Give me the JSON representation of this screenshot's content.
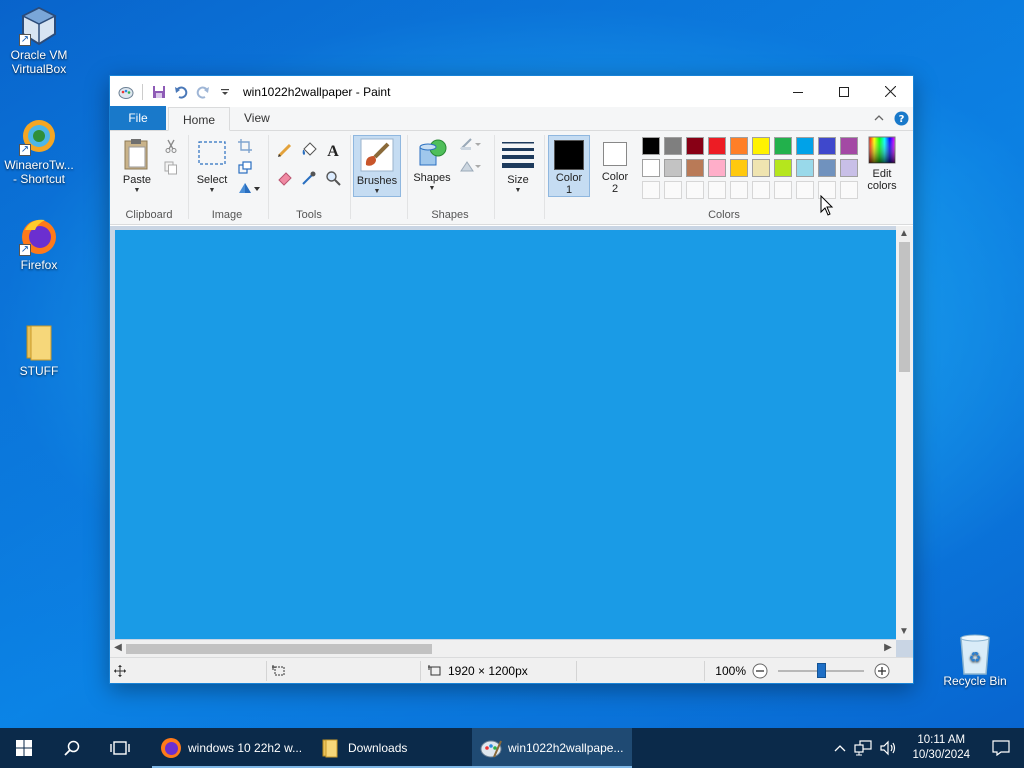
{
  "desktop": {
    "icons": [
      {
        "label": "Oracle VM VirtualBox"
      },
      {
        "label": "WinaeroTw... - Shortcut"
      },
      {
        "label": "Firefox"
      },
      {
        "label": "STUFF"
      },
      {
        "label": "Recycle Bin"
      }
    ]
  },
  "window": {
    "title": "win1022h2wallpaper - Paint"
  },
  "ribbon": {
    "tabs": {
      "file": "File",
      "home": "Home",
      "view": "View"
    },
    "groups": {
      "clipboard": {
        "label": "Clipboard",
        "paste": "Paste"
      },
      "image": {
        "label": "Image",
        "select": "Select"
      },
      "tools": {
        "label": "Tools"
      },
      "brushes": {
        "label": "Brushes"
      },
      "shapes": {
        "label": "Shapes",
        "shapes_btn": "Shapes"
      },
      "size": {
        "label": "Size"
      },
      "colors": {
        "label": "Colors",
        "color1": "Color\n1",
        "color1_a": "Color",
        "color1_b": "1",
        "color2_a": "Color",
        "color2_b": "2",
        "edit_a": "Edit",
        "edit_b": "colors",
        "color1_value": "#000000",
        "color2_value": "#ffffff",
        "palette_row1": [
          "#000000",
          "#7f7f7f",
          "#880015",
          "#ed1c24",
          "#ff7f27",
          "#fff200",
          "#22b14c",
          "#00a2e8",
          "#3f48cc",
          "#a349a4"
        ],
        "palette_row2": [
          "#ffffff",
          "#c3c3c3",
          "#b97a57",
          "#ffaec9",
          "#ffc90e",
          "#efe4b0",
          "#b5e61d",
          "#99d9ea",
          "#7092be",
          "#c8bfe7"
        ]
      }
    }
  },
  "canvas": {
    "fill_color": "#1a9be6"
  },
  "status": {
    "dimensions": "1920 × 1200px",
    "zoom": "100%",
    "zoom_level": 1.0
  },
  "taskbar": {
    "apps": [
      {
        "label": "windows 10 22h2 w..."
      },
      {
        "label": "Downloads"
      },
      {
        "label": "win1022h2wallpape..."
      }
    ],
    "time": "10:11 AM",
    "date": "10/30/2024"
  }
}
